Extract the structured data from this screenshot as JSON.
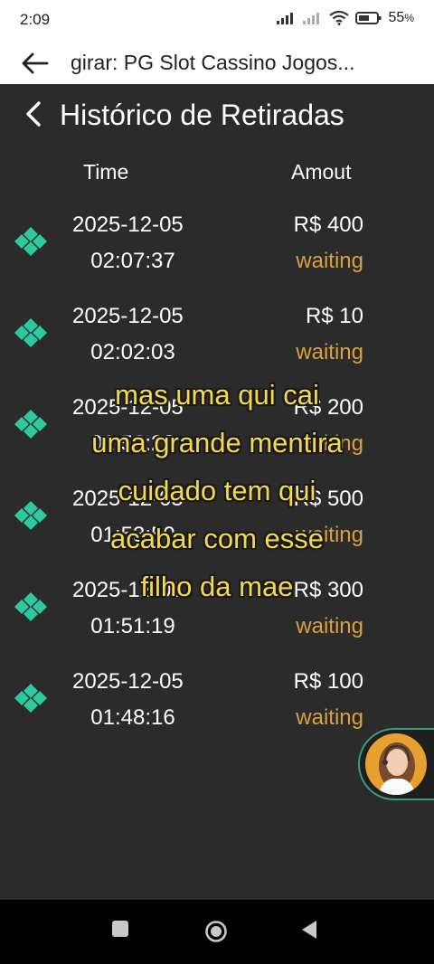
{
  "status": {
    "time": "2:09",
    "battery": "55"
  },
  "appbar": {
    "title": "girar: PG Slot Cassino Jogos..."
  },
  "page": {
    "title": "Histórico de Retiradas"
  },
  "columns": {
    "time": "Time",
    "amount": "Amout"
  },
  "rows": [
    {
      "date": "2025-12-05",
      "time": "02:07:37",
      "amount": "R$ 400",
      "status": "waiting"
    },
    {
      "date": "2025-12-05",
      "time": "02:02:03",
      "amount": "R$ 10",
      "status": "waiting"
    },
    {
      "date": "2025-12-05",
      "time": "01:56:28",
      "amount": "R$ 200",
      "status": "waiting"
    },
    {
      "date": "2025-12-05",
      "time": "01:53:50",
      "amount": "R$ 500",
      "status": "waiting"
    },
    {
      "date": "2025-12-05",
      "time": "01:51:19",
      "amount": "R$ 300",
      "status": "waiting"
    },
    {
      "date": "2025-12-05",
      "time": "01:48:16",
      "amount": "R$ 100",
      "status": "waiting"
    }
  ],
  "subtitles": [
    "mas uma qui cai",
    "uma grande mentira",
    "cuidado tem qui",
    "acabar com esse",
    "filho da mae"
  ],
  "colors": {
    "accent": "#2dc9a0",
    "status_waiting": "#d9a13f",
    "subtitle": "#f6d84e"
  }
}
